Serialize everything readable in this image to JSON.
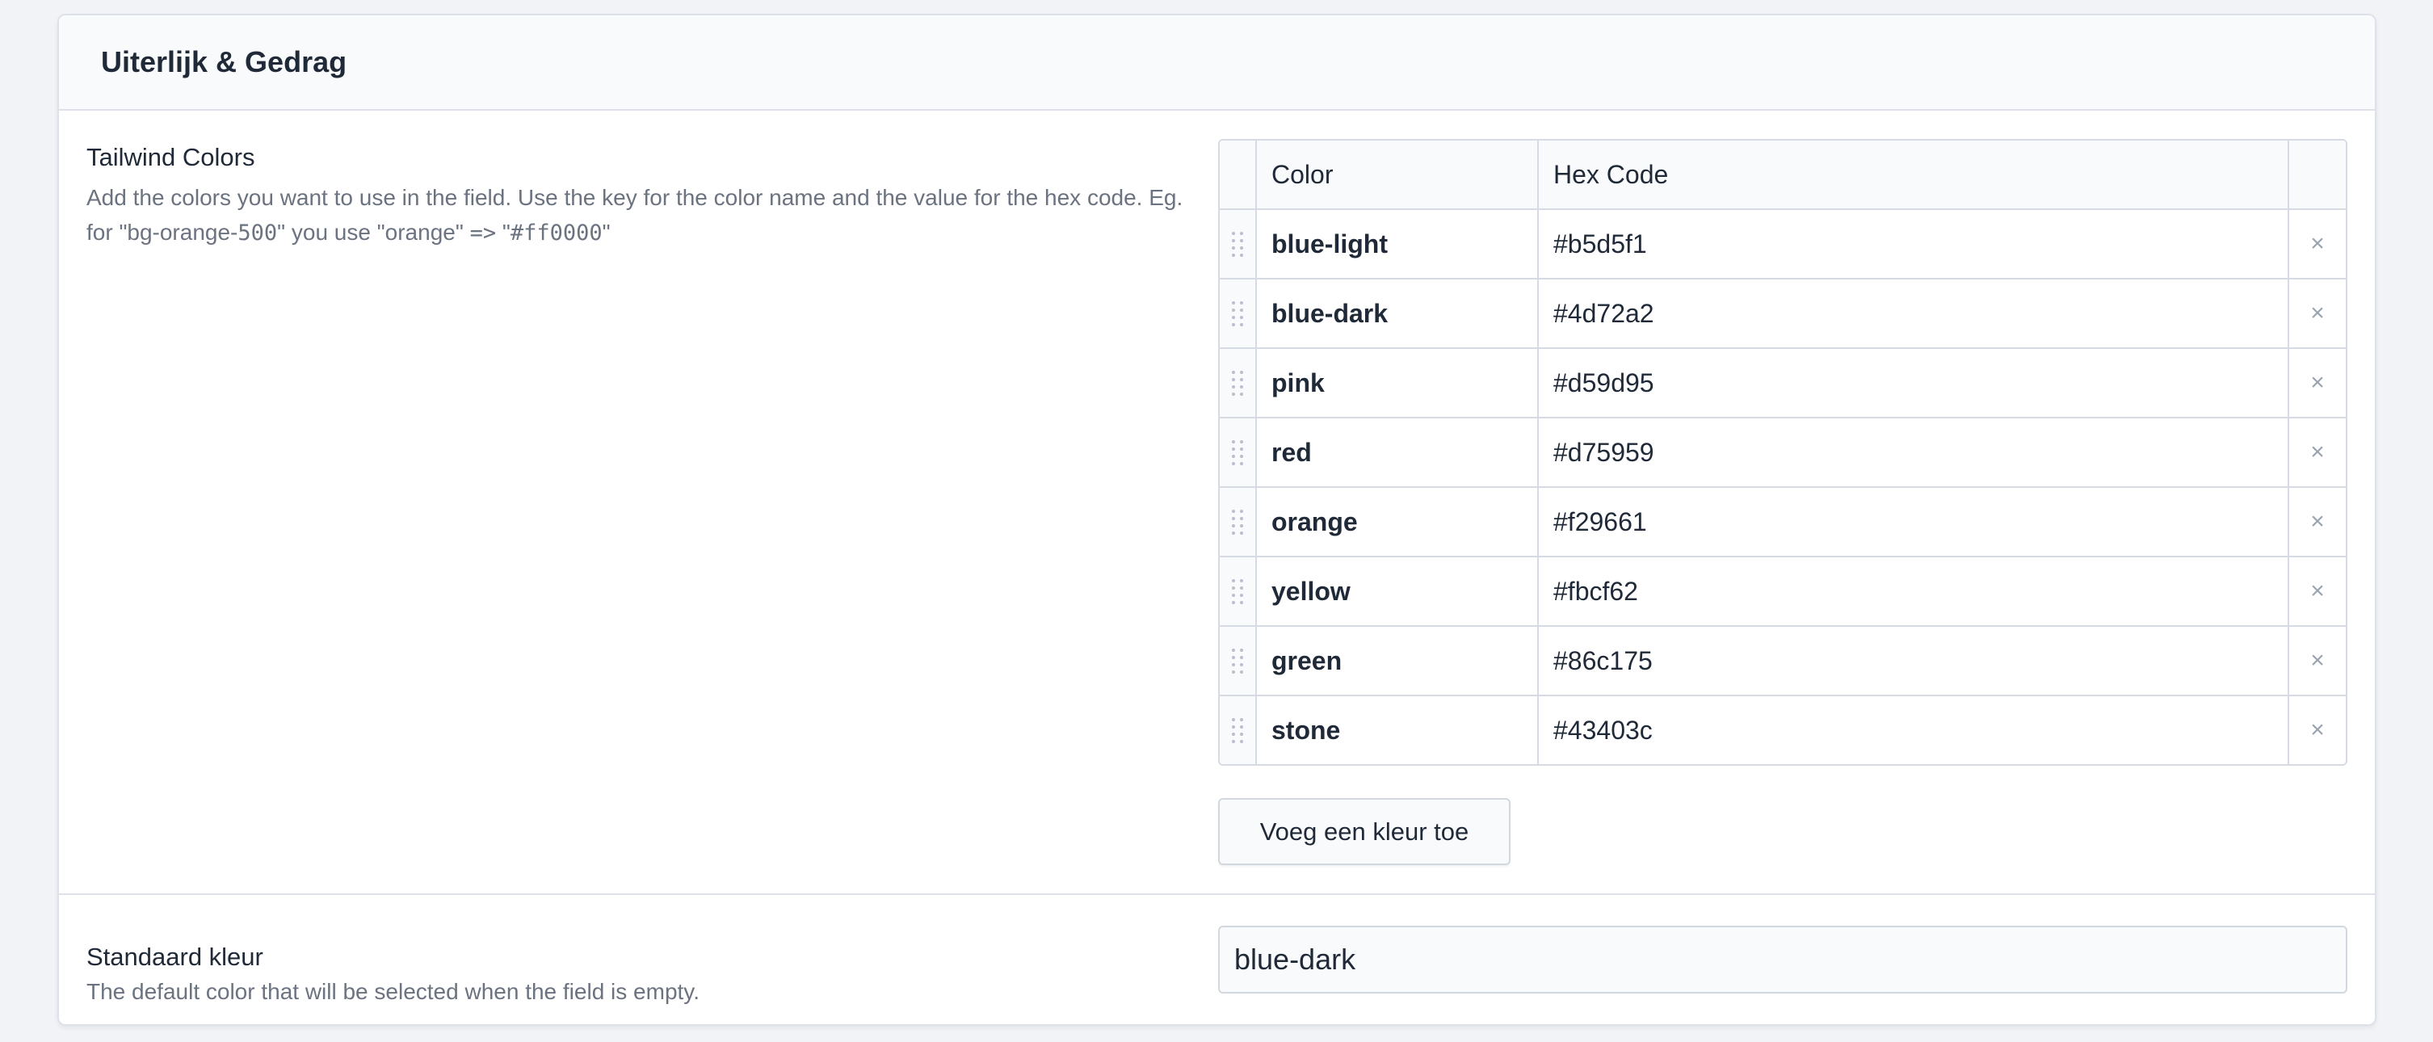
{
  "panel": {
    "title": "Uiterlijk & Gedrag"
  },
  "tailwind_colors": {
    "label": "Tailwind Colors",
    "description_lead": "Add the colors you want to use in the field. Use the key for the color name and the value for the hex code. Eg. for \"bg-orange-",
    "description_code1": "500",
    "description_mid": "\" you use \"orange\" ",
    "description_code2": "=>",
    "description_mid2": " \"",
    "description_code3": "#ff0000",
    "description_end": "\"",
    "columns": {
      "color": "Color",
      "hex": "Hex Code"
    },
    "rows": [
      {
        "key": "blue-light",
        "value": "#b5d5f1"
      },
      {
        "key": "blue-dark",
        "value": "#4d72a2"
      },
      {
        "key": "pink",
        "value": "#d59d95"
      },
      {
        "key": "red",
        "value": "#d75959"
      },
      {
        "key": "orange",
        "value": "#f29661"
      },
      {
        "key": "yellow",
        "value": "#fbcf62"
      },
      {
        "key": "green",
        "value": "#86c175"
      },
      {
        "key": "stone",
        "value": "#43403c"
      }
    ],
    "delete_glyph": "×",
    "add_button_label": "Voeg een kleur toe"
  },
  "default_color": {
    "label": "Standaard kleur",
    "description": "The default color that will be selected when the field is empty.",
    "value": "blue-dark"
  },
  "icons": {
    "drag_handle": "drag-handle-icon",
    "delete": "close-icon"
  }
}
